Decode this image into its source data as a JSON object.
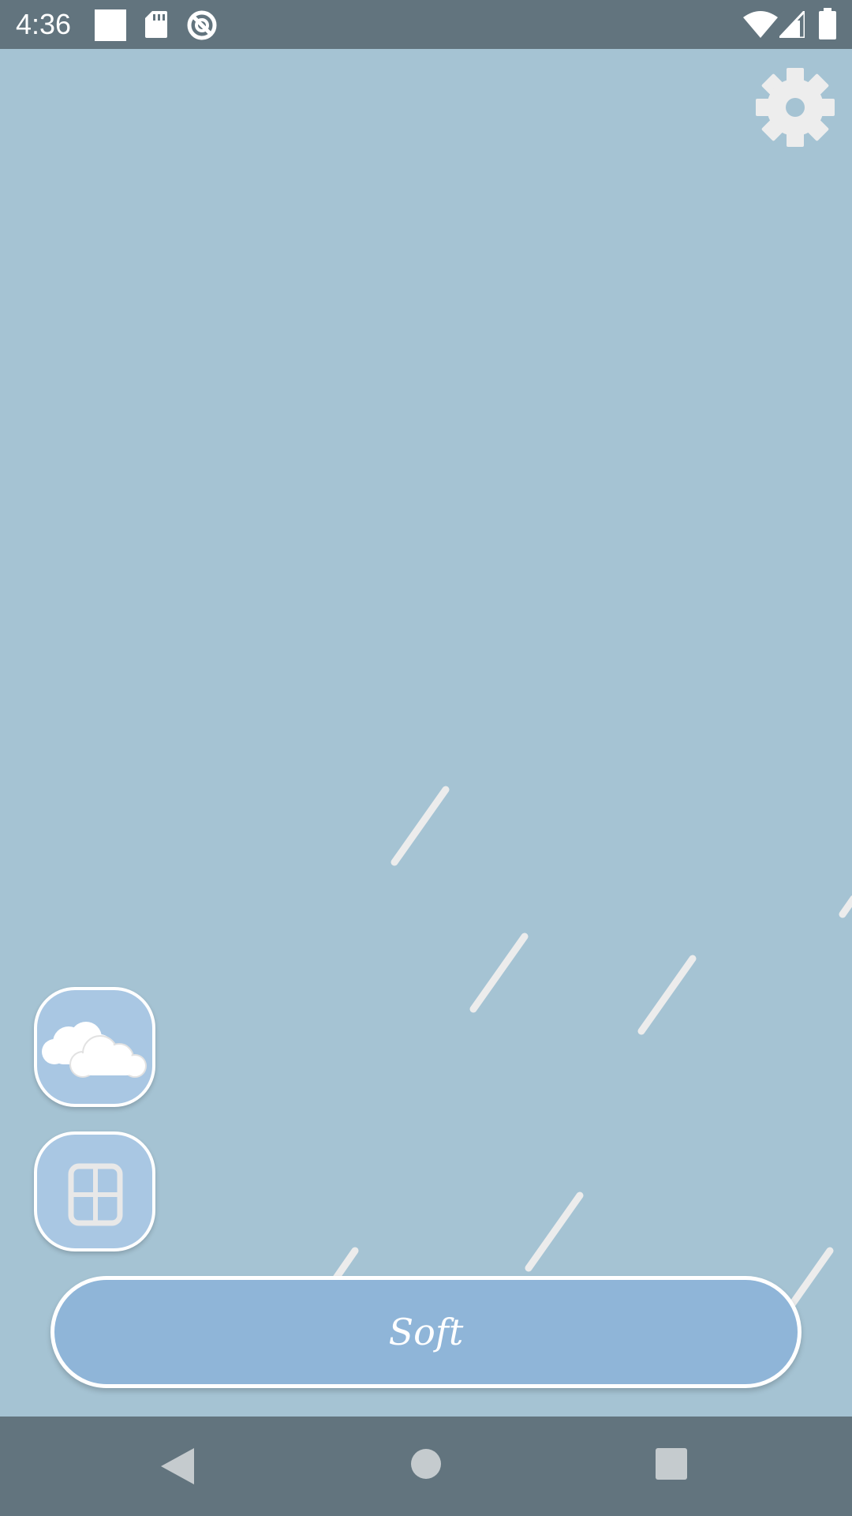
{
  "status_bar": {
    "time": "4:36",
    "left_icons": [
      "white-square-icon",
      "sd-card-icon",
      "no-disturb-icon"
    ],
    "right_icons": [
      "wifi-icon",
      "cell-signal-icon",
      "battery-icon"
    ]
  },
  "main": {
    "settings_icon": "gear-icon",
    "side_buttons": [
      {
        "icon": "cloud-icon"
      },
      {
        "icon": "window-icon"
      }
    ],
    "mode_button": {
      "label": "Soft"
    }
  },
  "nav_bar": {
    "buttons": [
      "back-icon",
      "home-icon",
      "recents-icon"
    ]
  },
  "colors": {
    "background": "#A5C3D3",
    "bars": "#62747E",
    "button_fill": "#8FB5D8",
    "side_button_fill": "#A9C7E3"
  }
}
